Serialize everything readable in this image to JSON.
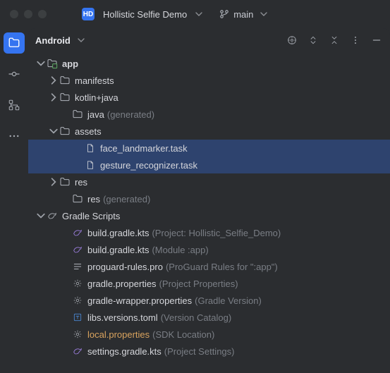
{
  "titlebar": {
    "project_initials": "HD",
    "project_name": "Hollistic Selfie Demo",
    "branch": "main"
  },
  "panel": {
    "title": "Android"
  },
  "tree": [
    {
      "depth": 0,
      "arrow": "down",
      "icon": "module",
      "label": "app",
      "bold": true
    },
    {
      "depth": 1,
      "arrow": "right",
      "icon": "folder",
      "label": "manifests"
    },
    {
      "depth": 1,
      "arrow": "right",
      "icon": "folder",
      "label": "kotlin+java"
    },
    {
      "depth": 2,
      "arrow": "none",
      "icon": "folder-gen",
      "label": "java",
      "hint": "(generated)"
    },
    {
      "depth": 1,
      "arrow": "down",
      "icon": "folder",
      "label": "assets"
    },
    {
      "depth": 3,
      "arrow": "none",
      "icon": "file",
      "label": "face_landmarker.task",
      "selected": true
    },
    {
      "depth": 3,
      "arrow": "none",
      "icon": "file",
      "label": "gesture_recognizer.task",
      "selected": true
    },
    {
      "depth": 1,
      "arrow": "right",
      "icon": "folder-res",
      "label": "res"
    },
    {
      "depth": 2,
      "arrow": "none",
      "icon": "folder-res",
      "label": "res",
      "hint": "(generated)"
    },
    {
      "depth": 0,
      "arrow": "down",
      "icon": "gradle",
      "label": "Gradle Scripts"
    },
    {
      "depth": 2,
      "arrow": "none",
      "icon": "kts",
      "label": "build.gradle.kts",
      "hint": "(Project: Hollistic_Selfie_Demo)"
    },
    {
      "depth": 2,
      "arrow": "none",
      "icon": "kts",
      "label": "build.gradle.kts",
      "hint": "(Module :app)"
    },
    {
      "depth": 2,
      "arrow": "none",
      "icon": "proguard",
      "label": "proguard-rules.pro",
      "hint": "(ProGuard Rules for \":app\")"
    },
    {
      "depth": 2,
      "arrow": "none",
      "icon": "gear",
      "label": "gradle.properties",
      "hint": "(Project Properties)"
    },
    {
      "depth": 2,
      "arrow": "none",
      "icon": "gear",
      "label": "gradle-wrapper.properties",
      "hint": "(Gradle Version)"
    },
    {
      "depth": 2,
      "arrow": "none",
      "icon": "toml",
      "label": "libs.versions.toml",
      "hint": "(Version Catalog)"
    },
    {
      "depth": 2,
      "arrow": "none",
      "icon": "gear",
      "label": "local.properties",
      "hint": "(SDK Location)",
      "warn": true
    },
    {
      "depth": 2,
      "arrow": "none",
      "icon": "kts",
      "label": "settings.gradle.kts",
      "hint": "(Project Settings)"
    }
  ]
}
